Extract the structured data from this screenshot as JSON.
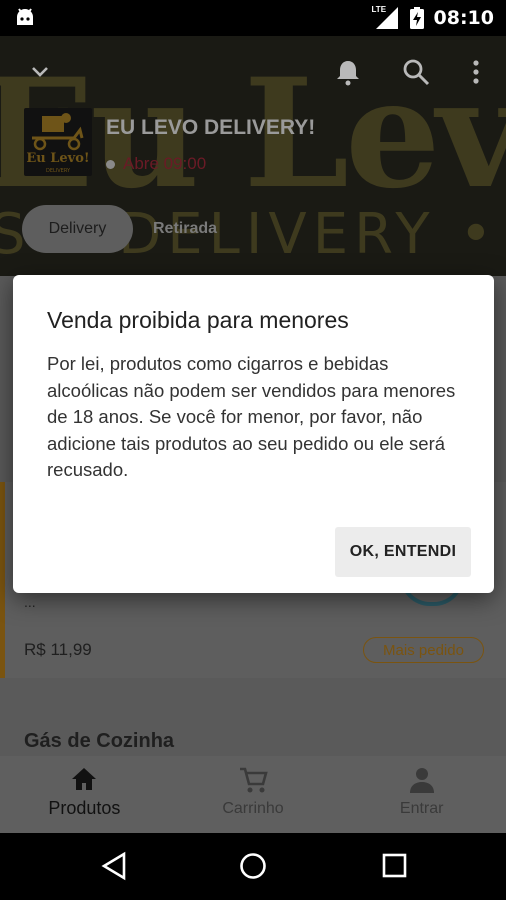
{
  "status_bar": {
    "time": "08:10",
    "network": "LTE"
  },
  "header": {
    "background_wordmark": "Eu Levo",
    "background_tagline": "S • DELIVERY •",
    "shop_name": "EU LEVO DELIVERY!",
    "open_status": "Abre 09:00",
    "logo_title": "Eu Levo!",
    "logo_subtitle": "DELIVERY",
    "tabs": [
      {
        "label": "Delivery",
        "selected": true
      },
      {
        "label": "Retirada",
        "selected": false
      }
    ]
  },
  "content": {
    "ellipsis": "...",
    "product_price": "R$ 11,99",
    "product_badge": "Mais pedido",
    "section_title": "Gás de Cozinha"
  },
  "bottom_nav": {
    "items": [
      {
        "label": "Produtos",
        "icon": "home-icon",
        "active": true
      },
      {
        "label": "Carrinho",
        "icon": "cart-icon",
        "active": false
      },
      {
        "label": "Entrar",
        "icon": "person-icon",
        "active": false
      }
    ]
  },
  "dialog": {
    "title": "Venda proibida para menores",
    "body": "Por lei, produtos como cigarros e bebidas alcoólicas não podem ser vendidos para menores de 18 anos. Se você for menor, por favor, não adicione tais produtos ao seu pedido ou ele será recusado.",
    "button_label": "OK, ENTENDI"
  },
  "colors": {
    "accent": "#c28a1c",
    "closed_status": "#b0283c",
    "overlay_dim": "rgba(0,0,0,0.62)"
  }
}
